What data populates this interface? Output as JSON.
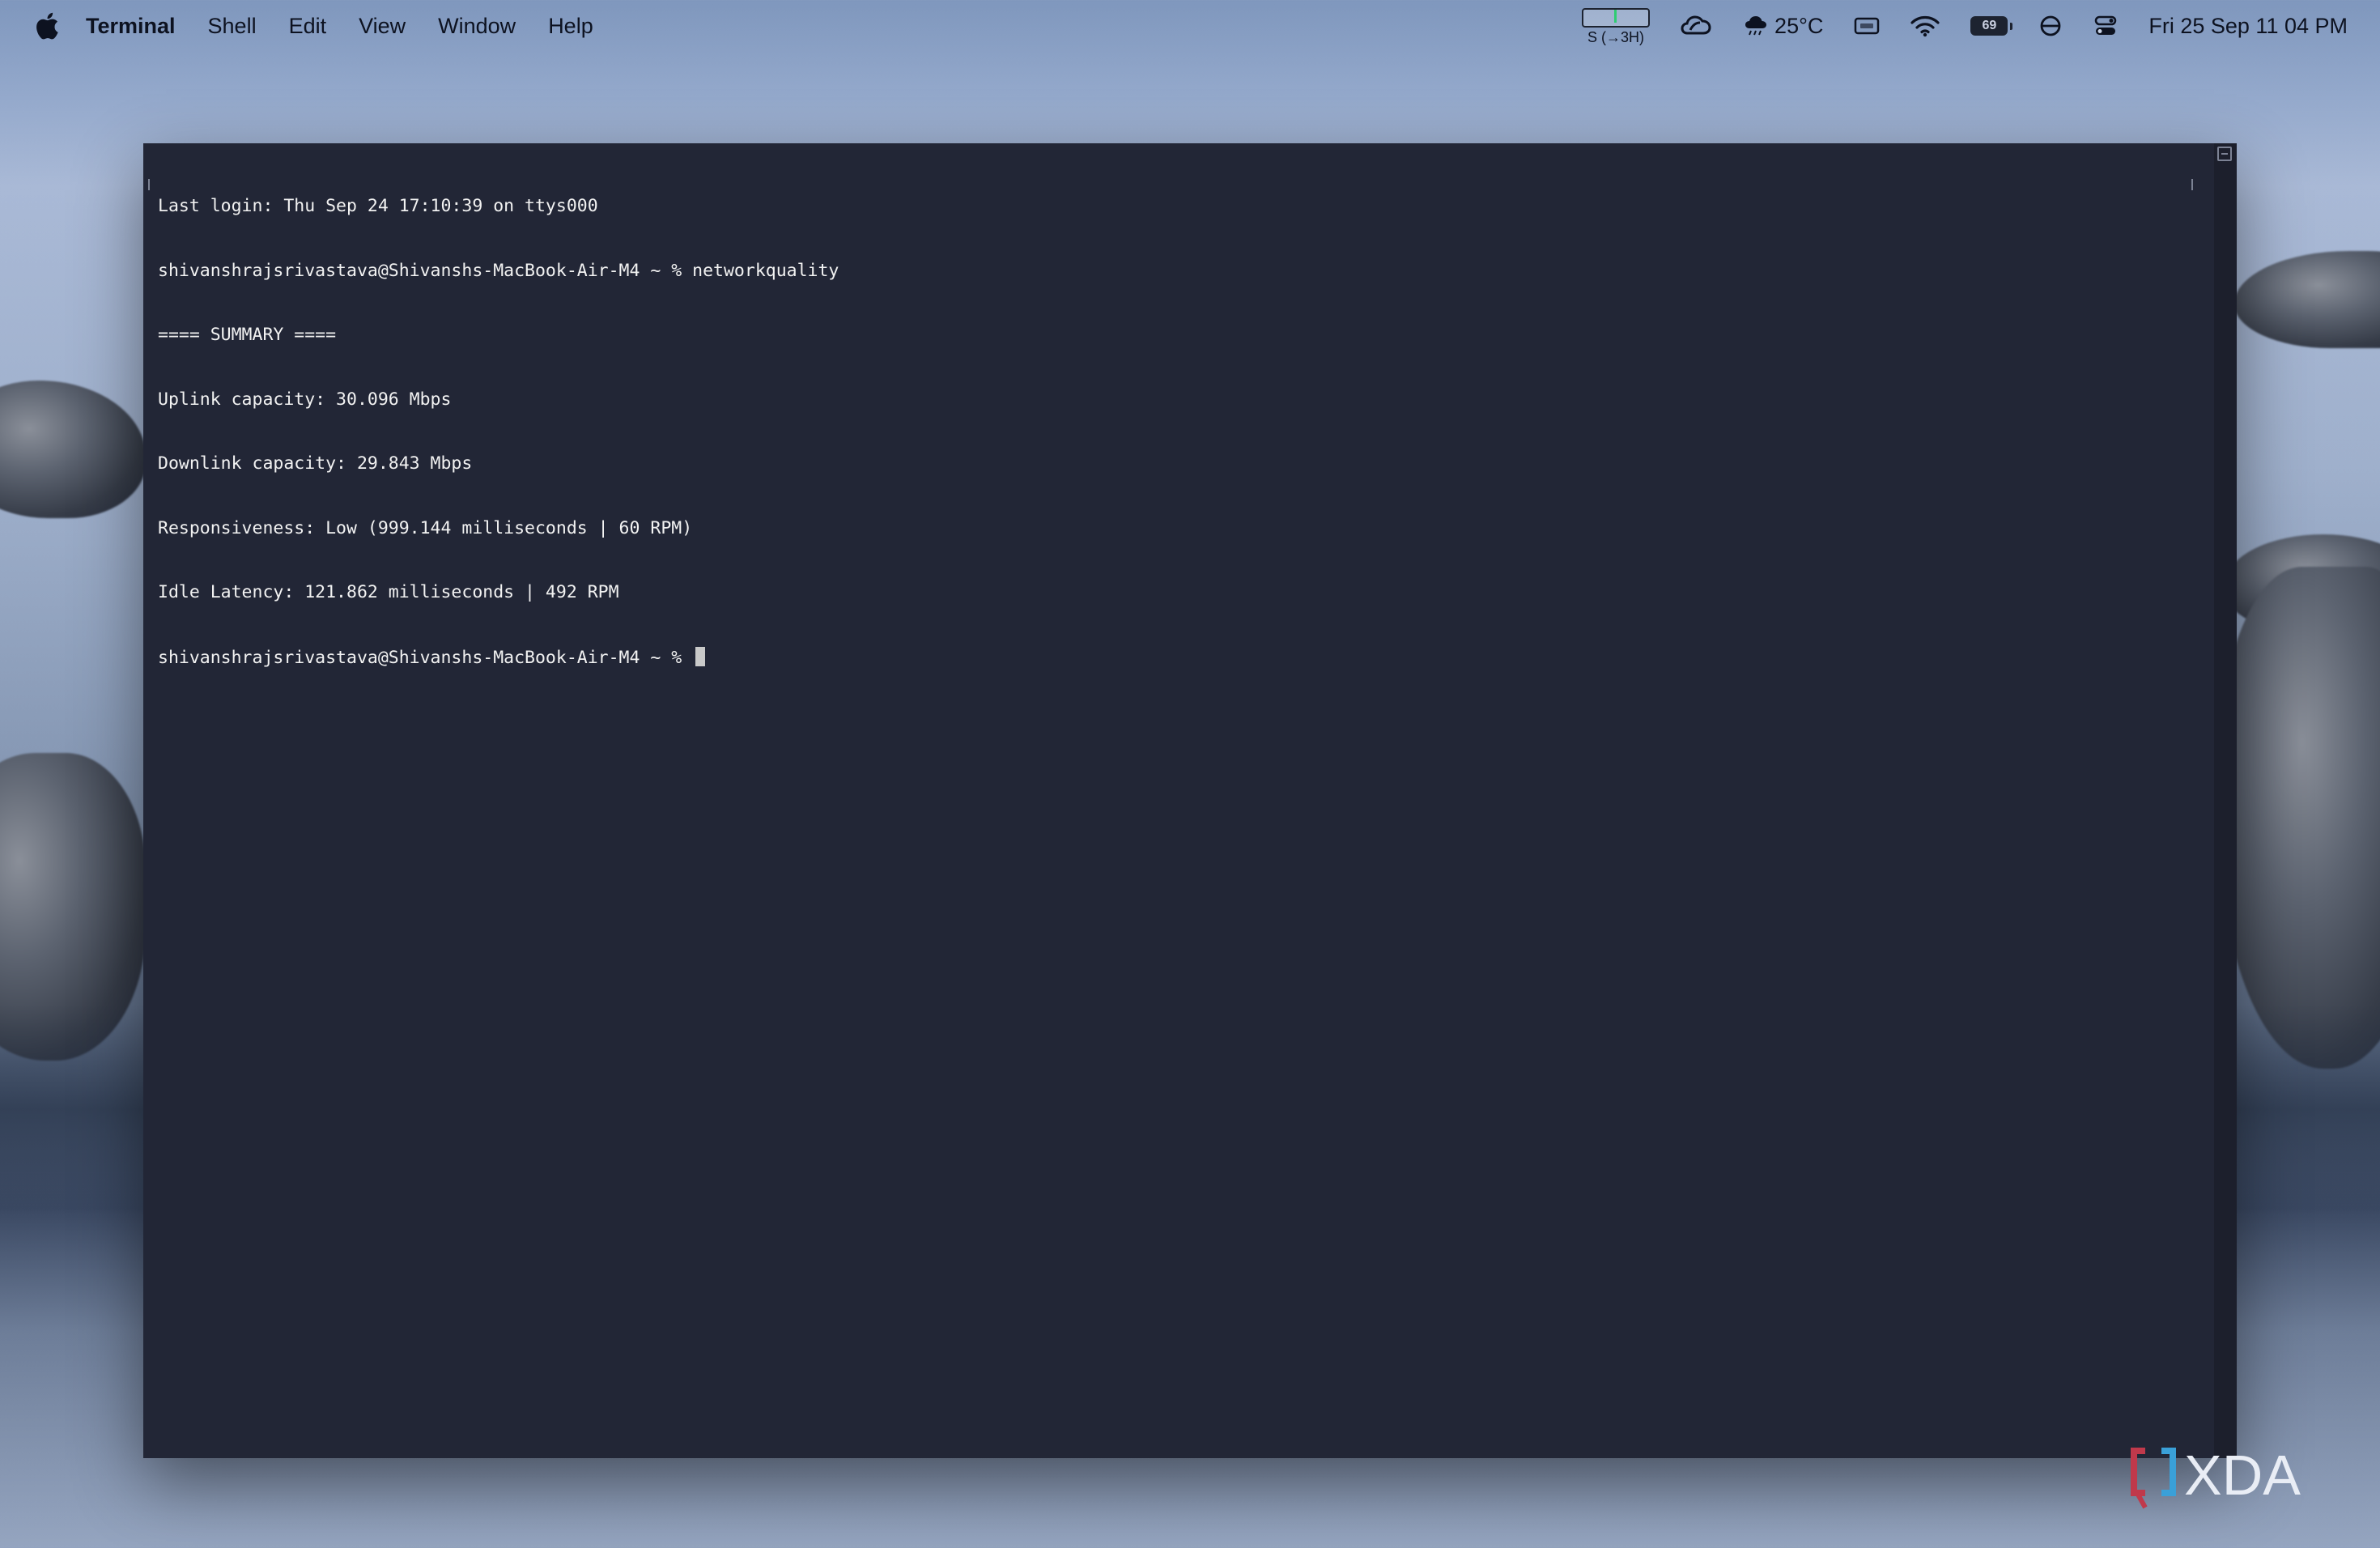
{
  "menubar": {
    "app_name": "Terminal",
    "items": [
      "Shell",
      "Edit",
      "View",
      "Window",
      "Help"
    ]
  },
  "status": {
    "cpu_label": "S (→3H)",
    "weather_temp": "25°C",
    "battery_percent": "69",
    "datetime": "Fri 25 Sep  11 04 PM"
  },
  "terminal": {
    "lines": [
      "Last login: Thu Sep 24 17:10:39 on ttys000",
      "shivanshrajsrivastava@Shivanshs-MacBook-Air-M4 ~ % networkquality",
      "==== SUMMARY ====",
      "Uplink capacity: 30.096 Mbps",
      "Downlink capacity: 29.843 Mbps",
      "Responsiveness: Low (999.144 milliseconds | 60 RPM)",
      "Idle Latency: 121.862 milliseconds | 492 RPM"
    ],
    "prompt": "shivanshrajsrivastava@Shivanshs-MacBook-Air-M4 ~ % "
  },
  "watermark": {
    "text": "XDA",
    "colors": {
      "bracket_red": "#c0394b",
      "bracket_blue": "#3aa0d8",
      "text": "#e9edf5"
    }
  }
}
